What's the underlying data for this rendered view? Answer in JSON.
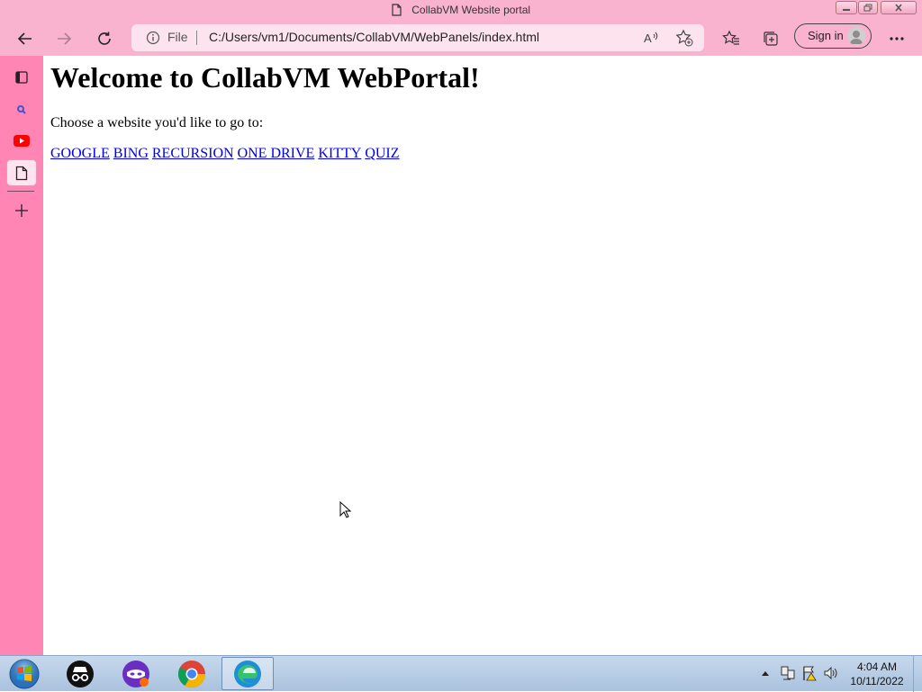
{
  "window": {
    "title": "CollabVM Website portal"
  },
  "address_bar": {
    "security_label": "File",
    "url": "C:/Users/vm1/Documents/CollabVM/WebPanels/index.html"
  },
  "profile": {
    "sign_in_label": "Sign in"
  },
  "page": {
    "heading": "Welcome to CollabVM WebPortal!",
    "intro": "Choose a website you'd like to go to:",
    "links": [
      "GOOGLE",
      "BING",
      "RECURSION",
      "ONE DRIVE",
      "KITTY",
      "QUIZ"
    ]
  },
  "taskbar": {
    "apps": [
      "start-button",
      "incognito-app",
      "mask-app",
      "chrome",
      "edge"
    ],
    "clock_time": "4:04 AM",
    "clock_date": "10/11/2022"
  },
  "colors": {
    "browser_chrome": "#f9b3cf",
    "sidebar": "#ff85b5",
    "link": "#0000ee"
  }
}
